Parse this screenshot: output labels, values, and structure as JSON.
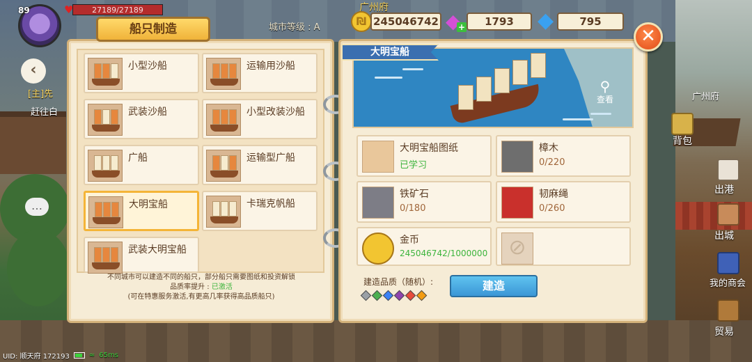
{
  "hud": {
    "level": "89",
    "hp_text": "27189/27189",
    "hp_fraction": 1.0,
    "city_name": "广州府",
    "city_level": "城市等级 : A",
    "gold": "245046742",
    "pink_gems": "1793",
    "blue_gems": "795",
    "close_label": "✕"
  },
  "left_hud": {
    "back_label": "‹",
    "quest_tag": "[主]先",
    "quest_text": "赶往白"
  },
  "panel_title": "船只制造",
  "ships": [
    {
      "name": "小型沙船"
    },
    {
      "name": "运输用沙船"
    },
    {
      "name": "武装沙船"
    },
    {
      "name": "小型改装沙船"
    },
    {
      "name": "广船"
    },
    {
      "name": "运输型广船"
    },
    {
      "name": "大明宝船"
    },
    {
      "name": "卡瑞克帆船"
    },
    {
      "name": "武装大明宝船"
    }
  ],
  "note": {
    "line1": "不同城市可以建造不同的船只，部分船只需要图纸和投资解锁",
    "line2_prefix": "品质率提升 : ",
    "line2_status": "已激活",
    "line3": "(可在特惠服务激活,有更高几率获得高品质船只)"
  },
  "selected_ship": {
    "name": "大明宝船",
    "view_label": "查看"
  },
  "materials": [
    {
      "name": "大明宝船图纸",
      "count": "已学习"
    },
    {
      "name": "樟木",
      "count": "0/220"
    },
    {
      "name": "铁矿石",
      "count": "0/180"
    },
    {
      "name": "韧麻绳",
      "count": "0/260"
    },
    {
      "name": "金币",
      "count": "245046742/1000000"
    }
  ],
  "build": {
    "quality_label": "建造品质（随机）:",
    "button_label": "建造",
    "quality_colors": [
      "#9aa0a6",
      "#4caf50",
      "#3b82f6",
      "#8e44ad",
      "#e74c3c",
      "#f39c12"
    ]
  },
  "side_menu": {
    "minimap_city": "广州府",
    "items": [
      {
        "label": "背包"
      },
      {
        "label": "出港"
      },
      {
        "label": "出城"
      },
      {
        "label": "我的商会"
      },
      {
        "label": "贸易"
      }
    ]
  },
  "status_bar": {
    "uid": "UID: 顺天府 172193",
    "ping": "65ms"
  }
}
